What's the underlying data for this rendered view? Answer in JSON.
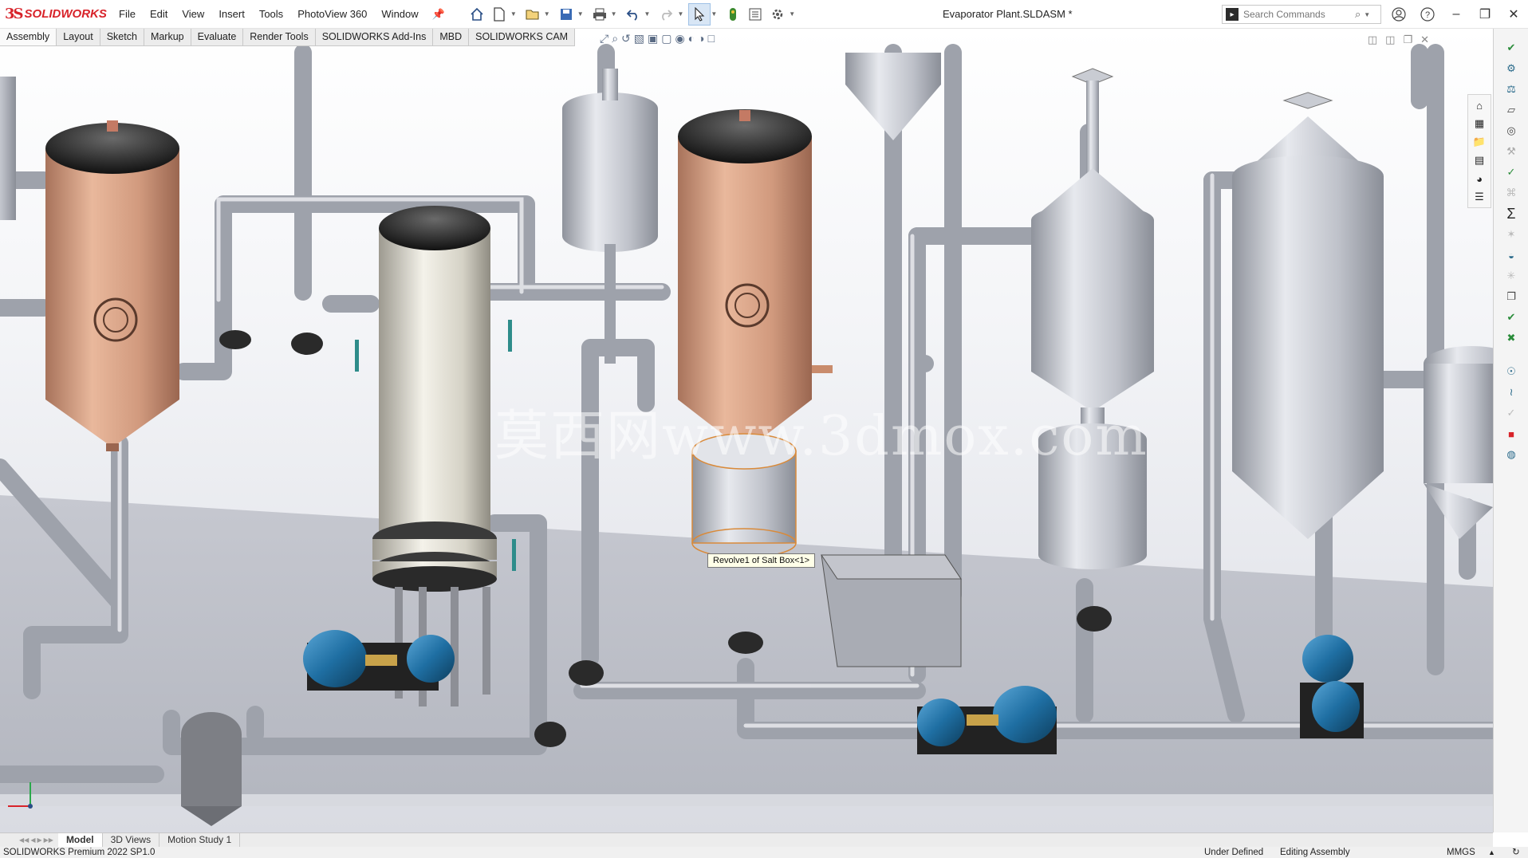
{
  "app": {
    "brand_mark": "3S",
    "brand_name": "SOLIDWORKS"
  },
  "menu": [
    "File",
    "Edit",
    "View",
    "Insert",
    "Tools",
    "PhotoView 360",
    "Window"
  ],
  "document": {
    "title": "Evaporator Plant.SLDASM *"
  },
  "search": {
    "placeholder": "Search Commands"
  },
  "tabs": [
    "Assembly",
    "Layout",
    "Sketch",
    "Markup",
    "Evaluate",
    "Render Tools",
    "SOLIDWORKS Add-Ins",
    "MBD",
    "SOLIDWORKS CAM"
  ],
  "active_tab": "Assembly",
  "viewport": {
    "tooltip": "Revolve1 of Salt Box<1>",
    "watermark": "莫西网www.3dmox.com"
  },
  "bottom_tabs": [
    "Model",
    "3D Views",
    "Motion Study 1"
  ],
  "status": {
    "product": "SOLIDWORKS Premium 2022 SP1.0",
    "definition": "Under Defined",
    "mode": "Editing Assembly",
    "units": "MMGS"
  },
  "colors": {
    "accent_red": "#d8232a",
    "copper": "#cf9576",
    "steel": "#b9bcc5",
    "pump_blue": "#1f6fa3"
  }
}
